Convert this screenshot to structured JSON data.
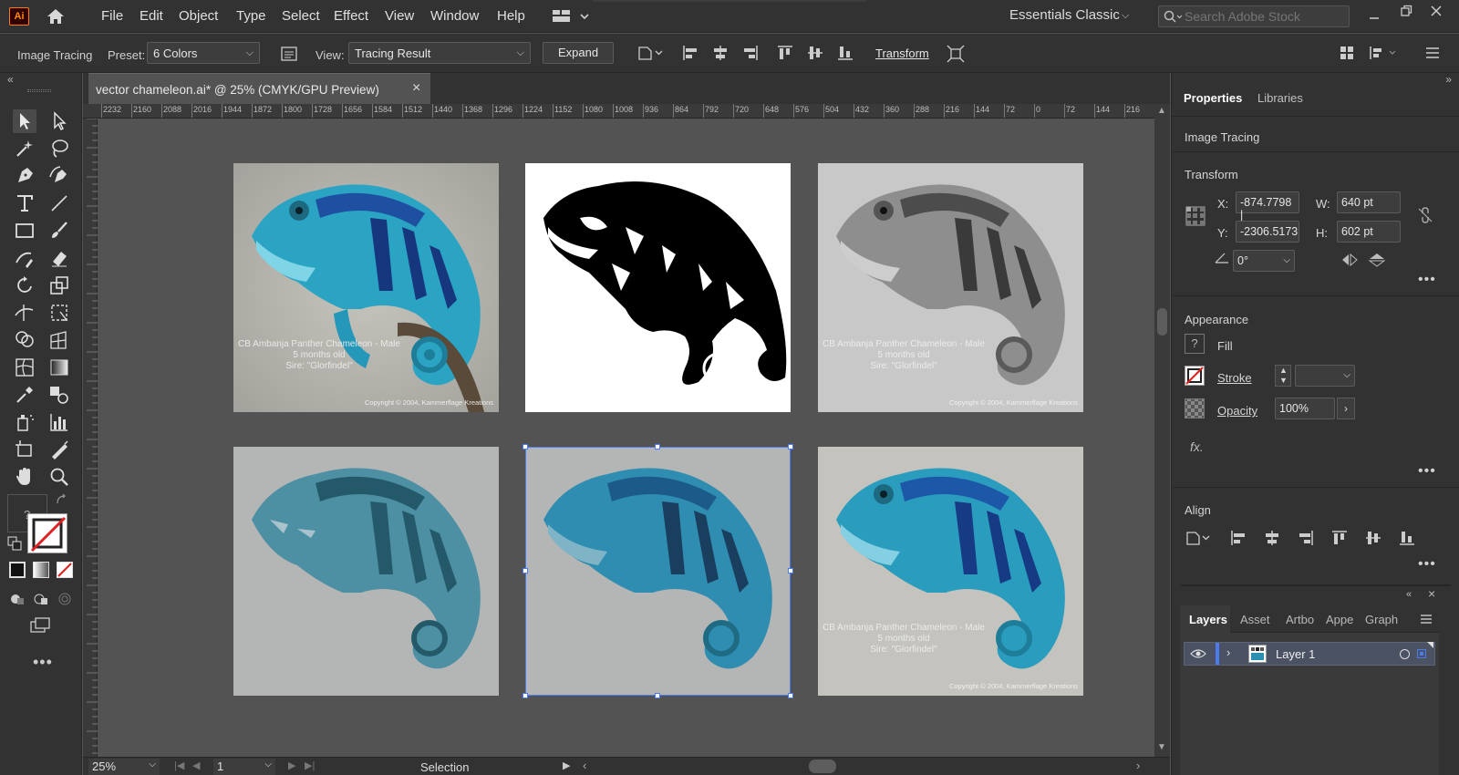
{
  "app": {
    "logo": "Ai",
    "home_icon": "home-icon"
  },
  "menu": [
    "File",
    "Edit",
    "Object",
    "Type",
    "Select",
    "Effect",
    "View",
    "Window",
    "Help"
  ],
  "workspace": "Essentials Classic",
  "search": {
    "placeholder": "Search Adobe Stock"
  },
  "control": {
    "mode": "Image Tracing",
    "preset_label": "Preset:",
    "preset_value": "6 Colors",
    "view_label": "View:",
    "view_value": "Tracing Result",
    "expand": "Expand",
    "transform": "Transform"
  },
  "document": {
    "tab_title": "vector chameleon.ai* @ 25% (CMYK/GPU Preview)",
    "close": "×"
  },
  "ruler": [
    "2232",
    "2160",
    "2088",
    "2016",
    "1944",
    "1872",
    "1800",
    "1728",
    "1656",
    "1584",
    "1512",
    "1440",
    "1368",
    "1296",
    "1224",
    "1152",
    "1080",
    "1008",
    "936",
    "864",
    "792",
    "720",
    "648",
    "576",
    "504",
    "432",
    "360",
    "288",
    "216",
    "144",
    "72",
    "0",
    "72",
    "144",
    "216"
  ],
  "artwork": {
    "caption_line1": "CB Ambanja Panther Chameleon - Male",
    "caption_line2": "5 months old",
    "caption_line3": "Sire: \"Glorfindel\"",
    "copyright": "Copyright © 2004, Kammerflage Kreations"
  },
  "status": {
    "zoom": "25%",
    "page": "1",
    "tool": "Selection"
  },
  "properties": {
    "tab_properties": "Properties",
    "tab_libraries": "Libraries",
    "section_tracing": "Image Tracing",
    "section_transform": "Transform",
    "x_label": "X:",
    "x_value": "-874.7798 |",
    "y_label": "Y:",
    "y_value": "-2306.5173",
    "w_label": "W:",
    "w_value": "640 pt",
    "h_label": "H:",
    "h_value": "602 pt",
    "angle_value": "0°",
    "section_appearance": "Appearance",
    "fill": "Fill",
    "stroke": "Stroke",
    "opacity": "Opacity",
    "opacity_value": "100%",
    "fx": "fx.",
    "section_align": "Align"
  },
  "layers": {
    "tabs": [
      "Layers",
      "Asset",
      "Artbo",
      "Appe",
      "Graph"
    ],
    "layer_name": "Layer 1"
  },
  "colors": {
    "accent": "#4b7bec",
    "chameleon_blue": "#2a8fb0",
    "dark_teal": "#2a5a6b"
  }
}
